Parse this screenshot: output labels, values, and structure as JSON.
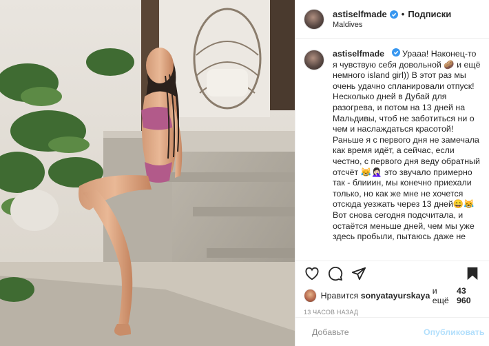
{
  "header": {
    "username": "astiselfmade",
    "separator": "•",
    "follow_label": "Подписки",
    "location": "Maldives"
  },
  "caption": {
    "username": "astiselfmade",
    "text": "Урааа! Наконец-то я чувствую себя довольной 🥔 и ещё немного island girl)) В этот раз мы очень удачно спланировали отпуск! Несколько дней в Дубай для разогрева, и потом на 13 дней на Мальдивы, чтоб не заботиться ни о чем и наслаждаться красотой! Раньше я с первого дня не замечала как время идёт, а сейчас, если честно, с первого дня веду обратный отсчёт 😹🤦🏻‍♀️ это звучало примерно так - блииин, мы конечно приехали только, но как же мне не хочется отсюда уезжать через 13 дней😄😹 Вот снова сегодня подсчитала, и остаётся меньше дней, чем мы уже здесь пробыли, пытаюсь даже не"
  },
  "icons": {
    "like": "heart-icon",
    "comment": "comment-icon",
    "share": "share-icon",
    "save": "bookmark-icon",
    "emoji": "emoji-icon",
    "verified": "verified-badge-icon"
  },
  "likes": {
    "prefix": "Нравится",
    "user": "sonyatayurskaya",
    "middle": "и ещё",
    "count": "43 960"
  },
  "timestamp": "13 ЧАСОВ НАЗАД",
  "composer": {
    "placeholder": "Добавьте",
    "publish_label": "Опубликовать"
  },
  "colors": {
    "verified": "#3897f0",
    "publish_disabled": "#b2dffc",
    "muted": "#8e8e8e"
  }
}
